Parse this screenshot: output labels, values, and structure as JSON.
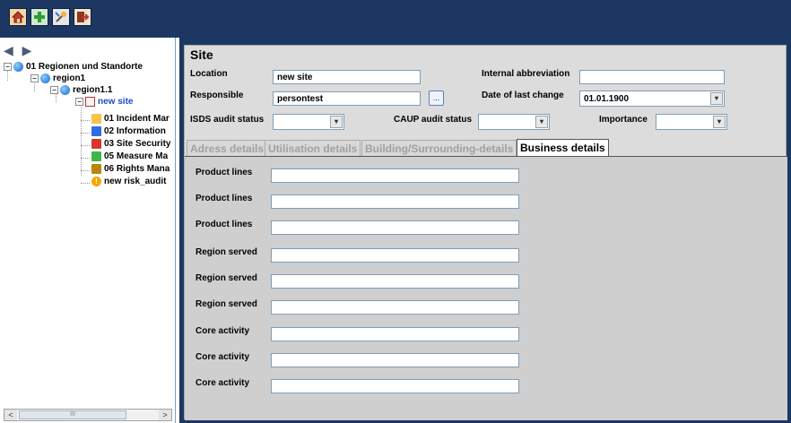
{
  "toolbar": {
    "buttons": [
      {
        "icon": "home-icon"
      },
      {
        "icon": "add-icon"
      },
      {
        "icon": "tools-icon"
      },
      {
        "icon": "exit-icon"
      }
    ]
  },
  "tree": {
    "nav": {
      "back": "◀",
      "forward": "▶"
    },
    "items": [
      {
        "label": "01 Regionen und Standorte",
        "icon": "globe-icon"
      },
      {
        "label": "region1",
        "icon": "globe-icon"
      },
      {
        "label": "region1.1",
        "icon": "globe-icon"
      },
      {
        "label": "new site",
        "icon": "house-icon"
      },
      {
        "label": "01 Incident Mar",
        "icon": "yellow-folder-icon"
      },
      {
        "label": "02 Information",
        "icon": "blue-folder-icon"
      },
      {
        "label": "03 Site Security",
        "icon": "red-folder-icon"
      },
      {
        "label": "05 Measure Ma",
        "icon": "green-folder-icon"
      },
      {
        "label": "06 Rights Mana",
        "icon": "lock-icon"
      },
      {
        "label": "new risk_audit",
        "icon": "warning-icon"
      }
    ],
    "toggle": "−",
    "scroll": {
      "left": "<",
      "right": ">",
      "grip": "III"
    }
  },
  "site": {
    "title": "Site",
    "location_label": "Location",
    "location_value": "new site",
    "abbrev_label": "Internal abbreviation",
    "abbrev_value": "",
    "responsible_label": "Responsible",
    "responsible_value": "persontest",
    "browse_label": "...",
    "date_label": "Date of last change",
    "date_value": "01.01.1900",
    "isds_label": "ISDS audit status",
    "isds_value": "",
    "caup_label": "CAUP audit status",
    "caup_value": "",
    "importance_label": "Importance",
    "importance_value": "",
    "dropdown_glyph": "▾"
  },
  "tabs": [
    {
      "label": "Adress details",
      "active": false
    },
    {
      "label": "Utilisation details",
      "active": false
    },
    {
      "label": "Building/Surrounding-details",
      "active": false
    },
    {
      "label": "Business details",
      "active": true
    }
  ],
  "business_rows": [
    {
      "label": "Product lines",
      "value": ""
    },
    {
      "label": "Product lines",
      "value": ""
    },
    {
      "label": "Product lines",
      "value": ""
    },
    {
      "label": "Region served",
      "value": ""
    },
    {
      "label": "Region served",
      "value": ""
    },
    {
      "label": "Region served",
      "value": ""
    },
    {
      "label": "Core activity",
      "value": ""
    },
    {
      "label": "Core activity",
      "value": ""
    },
    {
      "label": "Core activity",
      "value": ""
    }
  ],
  "colors": {
    "frame": "#1c3862",
    "panel": "#dcdcdc",
    "selected_tree_text": "#1a4fc6"
  }
}
